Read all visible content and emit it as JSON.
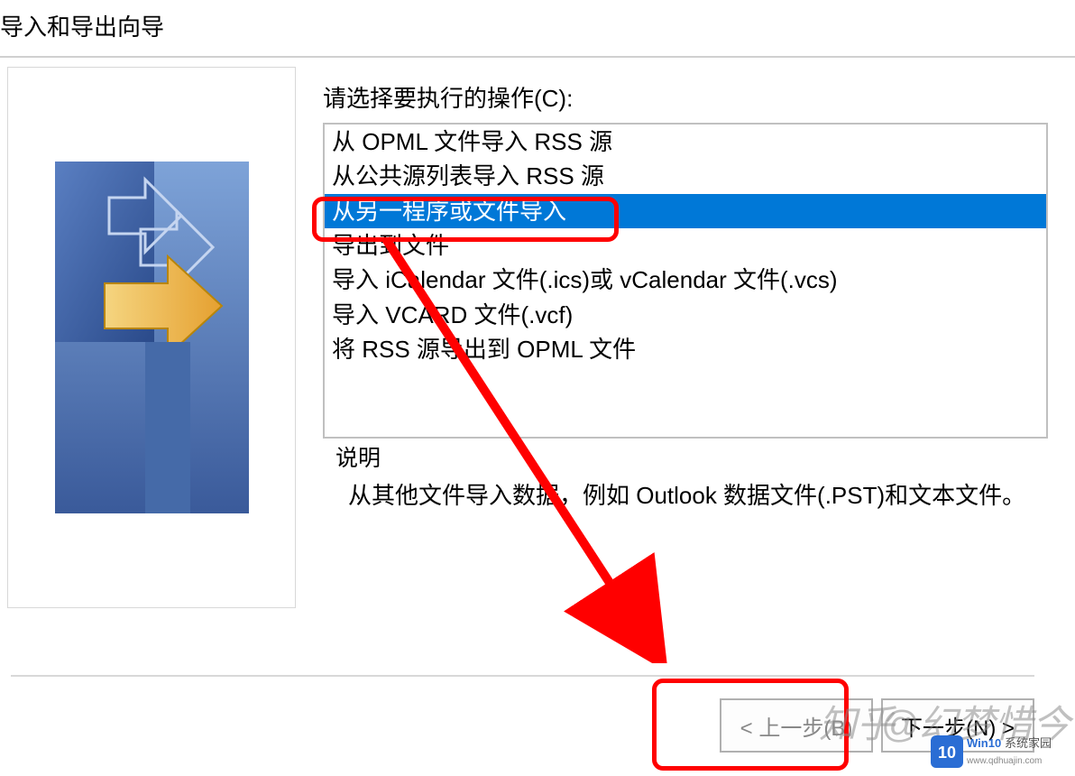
{
  "window": {
    "title": "导入和导出向导"
  },
  "prompt": "请选择要执行的操作(C):",
  "list": {
    "items": [
      "从 OPML 文件导入 RSS 源",
      "从公共源列表导入 RSS 源",
      "从另一程序或文件导入",
      "导出到文件",
      "导入 iCalendar 文件(.ics)或 vCalendar 文件(.vcs)",
      "导入 VCARD 文件(.vcf)",
      "将 RSS 源导出到 OPML 文件"
    ],
    "selected_index": 2
  },
  "description": {
    "label": "说明",
    "text": "从其他文件导入数据，例如 Outlook 数据文件(.PST)和文本文件。"
  },
  "buttons": {
    "back": "< 上一步(B)",
    "next": "下一步(N) >"
  },
  "watermarks": {
    "text1": "知乎",
    "text2": "@幻梦惜今",
    "logo_big": "Win10",
    "logo_small": "系统家园",
    "logo_url": "www.qdhuajin.com"
  },
  "colors": {
    "selection": "#0078d7",
    "highlight": "#ff0000"
  }
}
